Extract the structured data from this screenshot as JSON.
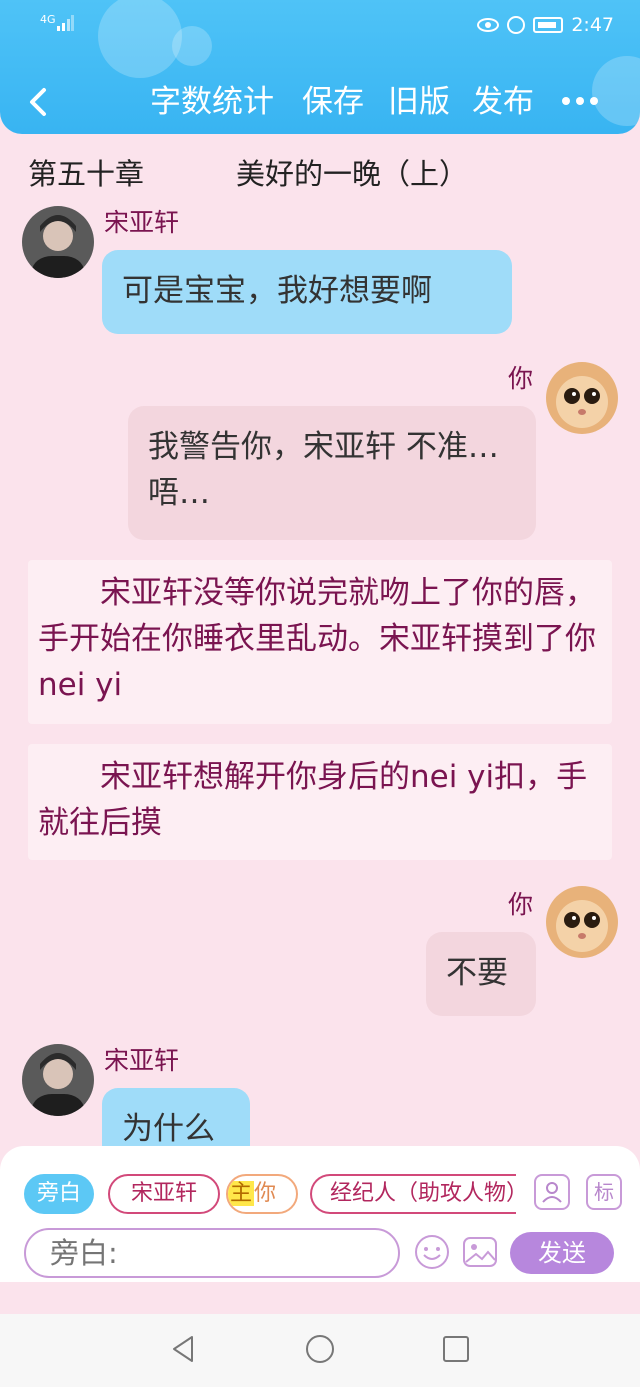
{
  "status_bar": {
    "network": "4G",
    "time": "2:47"
  },
  "toolbar": {
    "back_icon": "chevron-left-icon",
    "word_count_label": "字数统计",
    "save_label": "保存",
    "old_version_label": "旧版",
    "publish_label": "发布",
    "more_icon": "more-dots-icon"
  },
  "chapter": {
    "number": "第五十章",
    "title": "美好的一晚（上）"
  },
  "messages": [
    {
      "sender": "宋亚轩",
      "text": "可是宝宝，我好想要啊"
    },
    {
      "sender": "你",
      "text": "我警告你，宋亚轩 不准…唔…"
    },
    {
      "narration": "宋亚轩没等你说完就吻上了你的唇，手开始在你睡衣里乱动。宋亚轩摸到了你nei yi"
    },
    {
      "narration": "宋亚轩想解开你身后的nei yi扣，手就往后摸"
    },
    {
      "sender": "你",
      "text": "不要"
    },
    {
      "sender": "宋亚轩",
      "text": "为什么"
    }
  ],
  "roles": {
    "narrator": "旁白",
    "song": "宋亚轩",
    "main_mark": "主",
    "you": "你",
    "agent": "经纪人（助攻人物）"
  },
  "input": {
    "placeholder": "旁白:",
    "send_label": "发送",
    "tag_label": "标"
  },
  "colors": {
    "header": "#38b4f2",
    "background": "#fbe3ec",
    "left_bubble": "#9fdcf9",
    "right_bubble": "#f3d6de",
    "narration_text": "#7a1450",
    "send_button": "#b787dd"
  }
}
